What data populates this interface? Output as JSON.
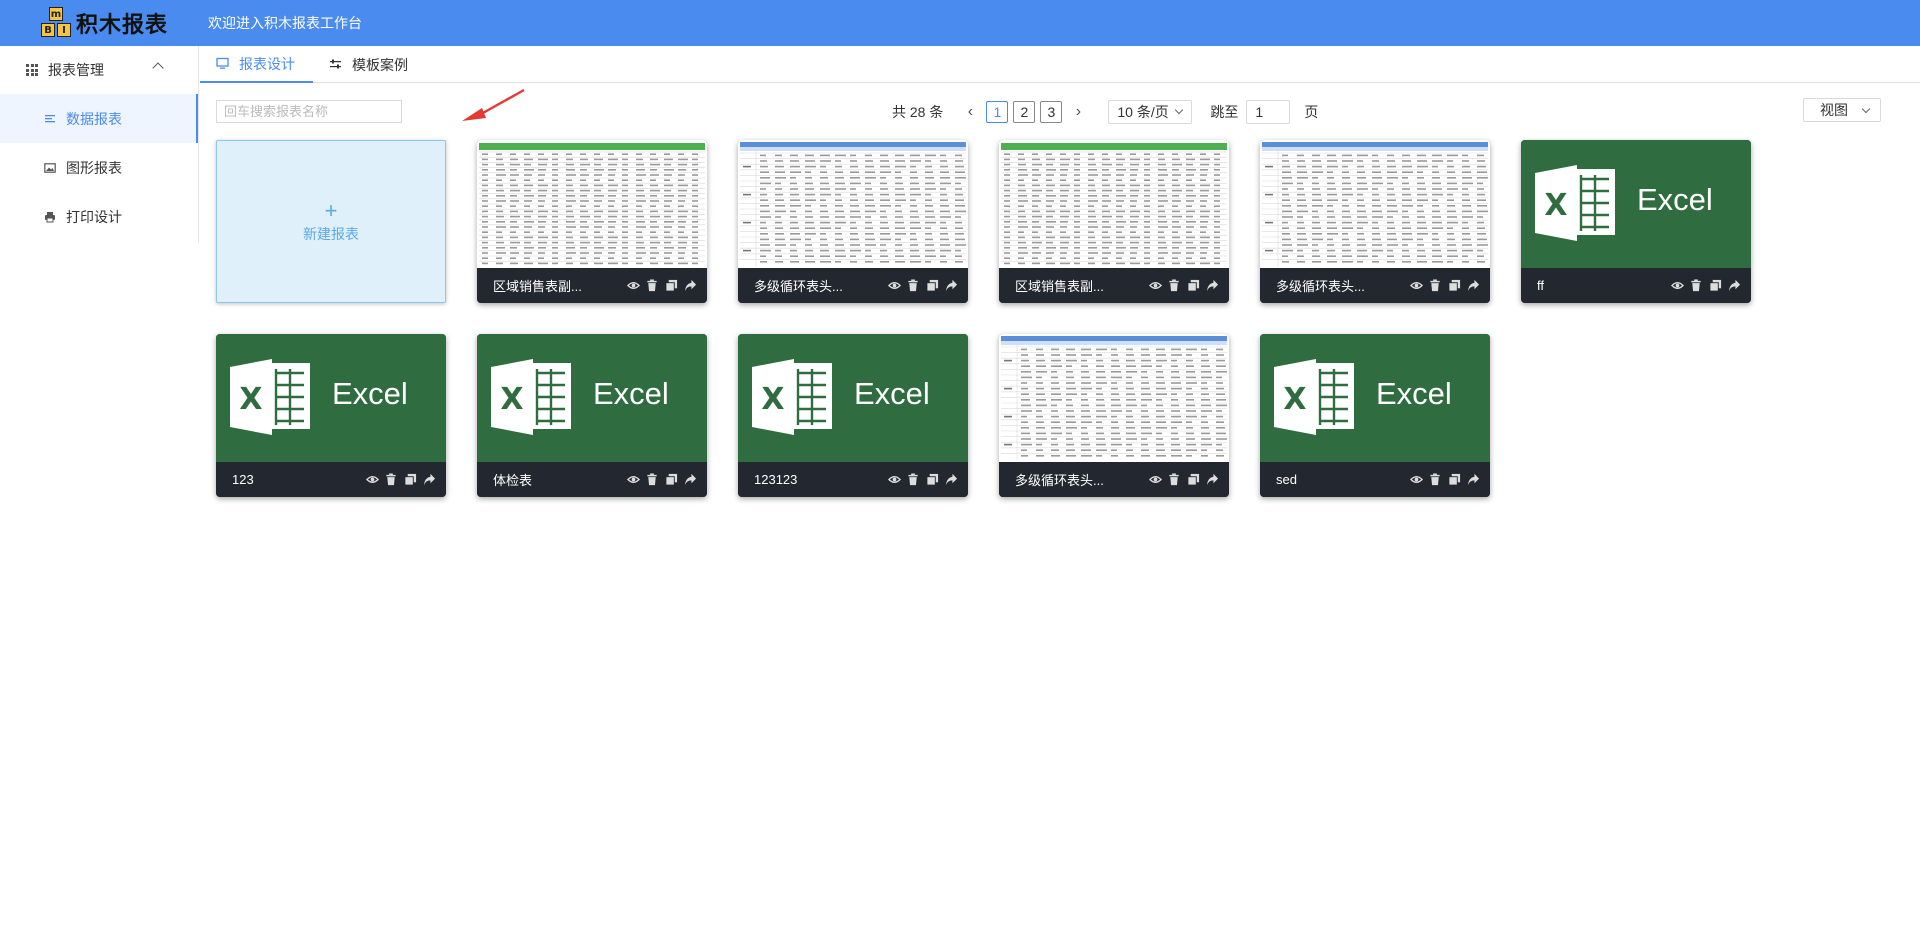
{
  "header": {
    "logo_text": "积木报表",
    "logo_letters": [
      "m",
      "B",
      "I"
    ],
    "welcome": "欢迎进入积木报表工作台"
  },
  "sidebar": {
    "group": "报表管理",
    "items": [
      {
        "label": "数据报表",
        "active": true
      },
      {
        "label": "图形报表",
        "active": false
      },
      {
        "label": "打印设计",
        "active": false
      }
    ]
  },
  "tabs": [
    {
      "label": "报表设计",
      "active": true
    },
    {
      "label": "模板案例",
      "active": false
    }
  ],
  "search": {
    "placeholder": "回车搜索报表名称"
  },
  "pagination": {
    "total": "共 28 条",
    "pages": [
      "1",
      "2",
      "3"
    ],
    "current": "1",
    "page_size": "10 条/页",
    "jump_label": "跳至",
    "jump_value": "1",
    "page_suffix": "页"
  },
  "view_select": "视图",
  "new_report": {
    "plus": "+",
    "label": "新建报表"
  },
  "excel_label": "Excel",
  "excel_logo_letter": "X",
  "cards": [
    {
      "name": "区域销售表副...",
      "thumb": "sheet-a"
    },
    {
      "name": "多级循环表头...",
      "thumb": "sheet-b"
    },
    {
      "name": "区域销售表副...",
      "thumb": "sheet-a"
    },
    {
      "name": "多级循环表头...",
      "thumb": "sheet-b"
    },
    {
      "name": "ff",
      "thumb": "excel"
    },
    {
      "name": "123",
      "thumb": "excel"
    },
    {
      "name": "体检表",
      "thumb": "excel"
    },
    {
      "name": "123123",
      "thumb": "excel"
    },
    {
      "name": "多级循环表头...",
      "thumb": "sheet-b"
    },
    {
      "name": "sed",
      "thumb": "excel"
    }
  ],
  "card_actions": [
    "eye-icon",
    "trash-icon",
    "copy-icon",
    "share-icon"
  ],
  "colors": {
    "header": "#4a8bf0",
    "accent": "#4a8bf0",
    "excel_green": "#2f6c3f",
    "card_bar": "#232830",
    "new_card_bg": "#dff0fb",
    "sheet_header_green": "#4caf50",
    "sheet_header_blue": "#5b8fd9"
  }
}
